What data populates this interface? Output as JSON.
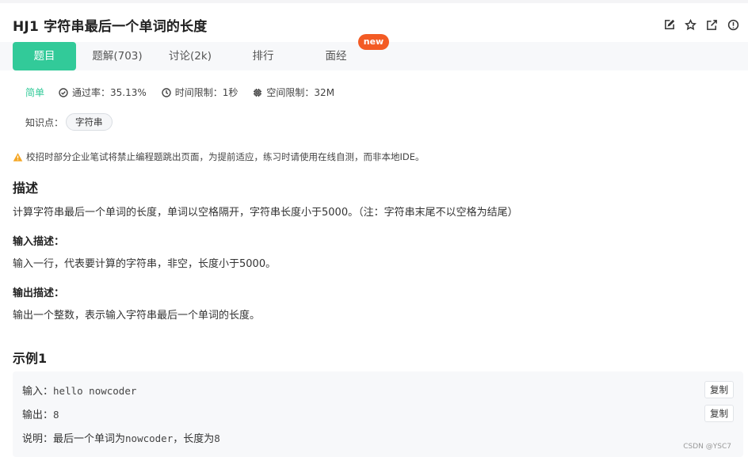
{
  "problem": {
    "title": "HJ1  字符串最后一个单词的长度"
  },
  "toolbar": {
    "icons": [
      "edit-icon",
      "star-icon",
      "share-icon",
      "info-icon"
    ]
  },
  "tabs": [
    {
      "label": "题目",
      "active": true
    },
    {
      "label": "题解(703)",
      "active": false
    },
    {
      "label": "讨论(2k)",
      "active": false
    },
    {
      "label": "排行",
      "active": false
    },
    {
      "label": "面经",
      "active": false
    }
  ],
  "badge_new": "new",
  "meta": {
    "difficulty": "简单",
    "pass_rate": "通过率：35.13%",
    "time_limit": "时间限制：1秒",
    "memory_limit": "空间限制：32M"
  },
  "knowledge": {
    "label": "知识点：",
    "tags": [
      "字符串"
    ]
  },
  "warning": "校招时部分企业笔试将禁止编程题跳出页面，为提前适应，练习时请使用在线自测，而非本地IDE。",
  "description": {
    "heading": "描述",
    "text": "计算字符串最后一个单词的长度，单词以空格隔开，字符串长度小于5000。（注：字符串末尾不以空格为结尾）"
  },
  "input_desc": {
    "heading": "输入描述：",
    "text": "输入一行，代表要计算的字符串，非空，长度小于5000。"
  },
  "output_desc": {
    "heading": "输出描述：",
    "text": "输出一个整数，表示输入字符串最后一个单词的长度。"
  },
  "example": {
    "heading": "示例1",
    "input_label": "输入：",
    "input_value": "hello nowcoder",
    "output_label": "输出：",
    "output_value": "8",
    "explain_label": "说明：",
    "explain_text": "最后一个单词为",
    "explain_code": "nowcoder",
    "explain_tail": "，长度为",
    "explain_num": "8",
    "copy_label": "复制"
  },
  "watermark": "CSDN @YSC7",
  "colors": {
    "accent": "#32ca99",
    "new_badge": "#f35b24",
    "warning": "#f5a623"
  }
}
